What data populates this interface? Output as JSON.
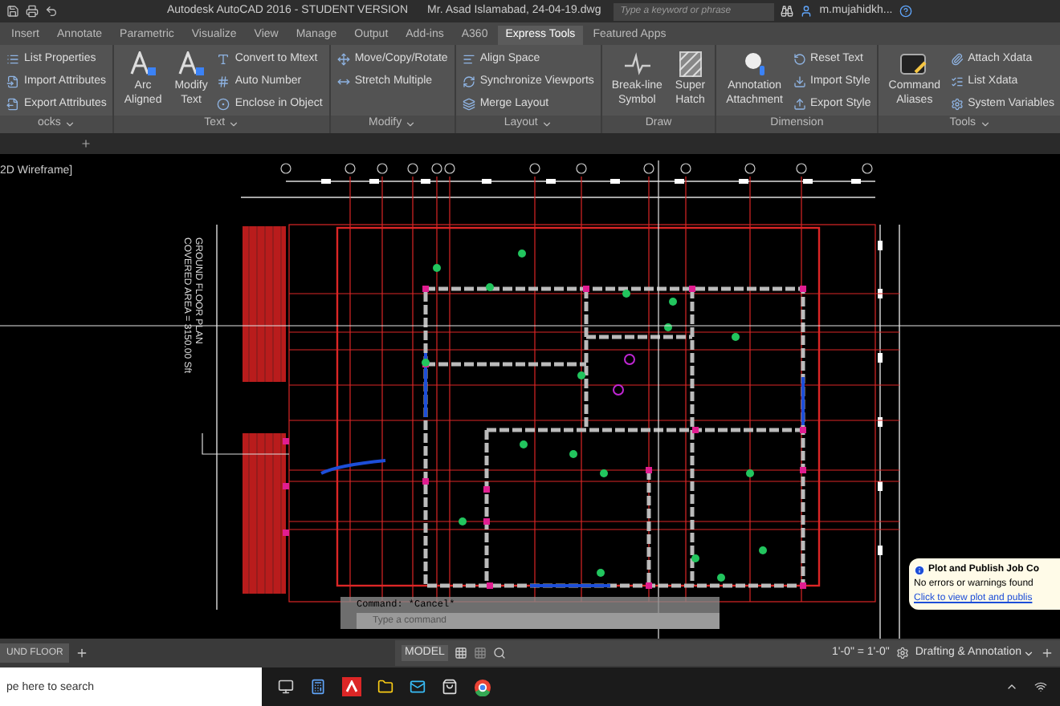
{
  "title_bar": {
    "title": "Autodesk AutoCAD 2016 - STUDENT VERSION",
    "file": "Mr. Asad Islamabad, 24-04-19.dwg",
    "search": {
      "placeholder": "Type a keyword or phrase"
    },
    "user": "m.mujahidkh..."
  },
  "tabs": [
    {
      "label": "Insert",
      "selected": false
    },
    {
      "label": "Annotate",
      "selected": false
    },
    {
      "label": "Parametric",
      "selected": false
    },
    {
      "label": "Visualize",
      "selected": false
    },
    {
      "label": "View",
      "selected": false
    },
    {
      "label": "Manage",
      "selected": false
    },
    {
      "label": "Output",
      "selected": false
    },
    {
      "label": "Add-ins",
      "selected": false
    },
    {
      "label": "A360",
      "selected": false
    },
    {
      "label": "Express Tools",
      "selected": true
    },
    {
      "label": "Featured Apps",
      "selected": false
    }
  ],
  "ribbon": [
    {
      "footer": "ocks",
      "dropdown": true,
      "items": [
        {
          "kind": "small",
          "label": "List Properties"
        },
        {
          "kind": "small",
          "label": "Import Attributes"
        },
        {
          "kind": "small",
          "label": "Export Attributes"
        }
      ]
    },
    {
      "footer": "Text",
      "dropdown": true,
      "items": [
        {
          "kind": "large",
          "lines": [
            "Arc",
            "Aligned"
          ]
        },
        {
          "kind": "large",
          "lines": [
            "Modify",
            "Text"
          ]
        },
        {
          "kind": "small",
          "label": "Convert to Mtext"
        },
        {
          "kind": "small",
          "label": "Auto Number"
        },
        {
          "kind": "small",
          "label": "Enclose in Object"
        }
      ]
    },
    {
      "footer": "Modify",
      "dropdown": true,
      "items": [
        {
          "kind": "small",
          "label": "Move/Copy/Rotate"
        },
        {
          "kind": "small",
          "label": "Stretch Multiple"
        }
      ]
    },
    {
      "footer": "Layout",
      "dropdown": true,
      "items": [
        {
          "kind": "small",
          "label": "Align Space"
        },
        {
          "kind": "small",
          "label": "Synchronize Viewports"
        },
        {
          "kind": "small",
          "label": "Merge Layout"
        }
      ]
    },
    {
      "footer": "Draw",
      "dropdown": false,
      "items": [
        {
          "kind": "large",
          "lines": [
            "Break-line",
            "Symbol"
          ]
        },
        {
          "kind": "large",
          "lines": [
            "Super",
            "Hatch"
          ]
        }
      ]
    },
    {
      "footer": "Dimension",
      "dropdown": false,
      "items": [
        {
          "kind": "large",
          "lines": [
            "Annotation",
            "Attachment"
          ]
        },
        {
          "kind": "small",
          "label": "Reset Text"
        },
        {
          "kind": "small",
          "label": "Import Style"
        },
        {
          "kind": "small",
          "label": "Export Style"
        }
      ]
    },
    {
      "footer": "Tools",
      "dropdown": true,
      "items": [
        {
          "kind": "large",
          "lines": [
            "Command",
            "Aliases"
          ]
        },
        {
          "kind": "small",
          "label": "Attach Xdata"
        },
        {
          "kind": "small",
          "label": "List Xdata"
        },
        {
          "kind": "small",
          "label": "System Variables"
        }
      ]
    }
  ],
  "viewport": {
    "label": "2D Wireframe]",
    "plan_title": "GROUND FLOOR PLAN",
    "plan_area": "COVERED AREA = 3150.00 Sft"
  },
  "command_line": {
    "history": "Command: *Cancel*",
    "placeholder": "Type a command"
  },
  "notification": {
    "title": "Plot and Publish Job Co",
    "message": "No errors or warnings found",
    "link": "Click to view plot and publis"
  },
  "layout_tabs": [
    {
      "label": "UND FLOOR",
      "selected": true
    }
  ],
  "status_bar": {
    "model": "MODEL",
    "scale": "1'-0\" = 1'-0\"",
    "workspace": "Drafting & Annotation"
  },
  "taskbar": {
    "search": {
      "placeholder": "pe here to search"
    }
  }
}
